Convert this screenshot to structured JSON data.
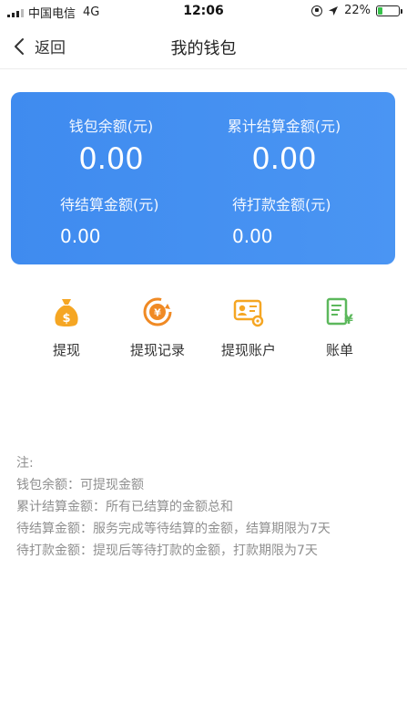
{
  "status_bar": {
    "carrier": "中国电信",
    "network": "4G",
    "time": "12:06",
    "battery_text": "22%",
    "battery_level": 0.22
  },
  "nav": {
    "back_label": "返回",
    "title": "我的钱包"
  },
  "wallet": {
    "balance_label": "钱包余额(元)",
    "balance_value": "0.00",
    "total_settled_label": "累计结算金额(元)",
    "total_settled_value": "0.00",
    "pending_settle_label": "待结算金额(元)",
    "pending_settle_value": "0.00",
    "pending_pay_label": "待打款金额(元)",
    "pending_pay_value": "0.00"
  },
  "functions": [
    {
      "label": "提现",
      "icon": "money-bag-icon"
    },
    {
      "label": "提现记录",
      "icon": "yuan-refresh-icon"
    },
    {
      "label": "提现账户",
      "icon": "id-card-gear-icon"
    },
    {
      "label": "账单",
      "icon": "bill-yuan-icon"
    }
  ],
  "notes": [
    "注:",
    "钱包余额：可提现金额",
    "累计结算金额：所有已结算的金额总和",
    "待结算金额：服务完成等待结算的金额，结算期限为7天",
    "待打款金额：提现后等待打款的金额，打款期限为7天"
  ],
  "colors": {
    "card_blue": "#4390f1",
    "icon_orange": "#f39c12",
    "icon_green": "#5cb85c"
  }
}
